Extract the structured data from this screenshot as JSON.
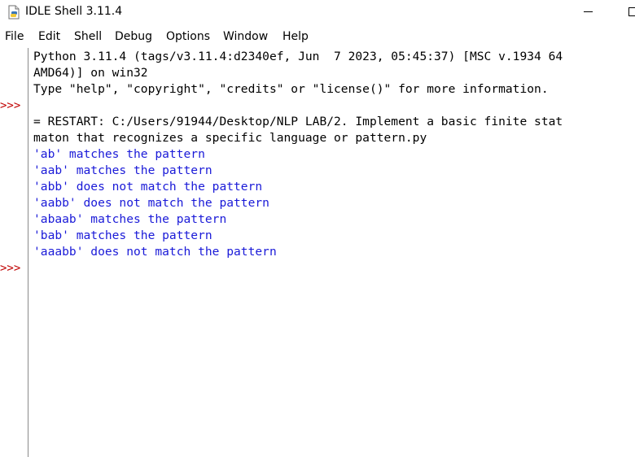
{
  "window": {
    "title": "IDLE Shell 3.11.4",
    "icon": "python-idle-icon"
  },
  "menu": [
    "File",
    "Edit",
    "Shell",
    "Debug",
    "Options",
    "Window",
    "Help"
  ],
  "shell": {
    "prompt": ">>>",
    "lines": [
      "Python 3.11.4 (tags/v3.11.4:d2340ef, Jun  7 2023, 05:45:37) [MSC v.1934 64",
      "AMD64)] on win32",
      "Type \"help\", \"copyright\", \"credits\" or \"license()\" for more information.",
      "",
      "= RESTART: C:/Users/91944/Desktop/NLP LAB/2. Implement a basic finite stat",
      "maton that recognizes a specific language or pattern.py",
      "'ab' matches the pattern",
      "'aab' matches the pattern",
      "'abb' does not match the pattern",
      "'aabb' does not match the pattern",
      "'abaab' matches the pattern",
      "'bab' matches the pattern",
      "'aaabb' does not match the pattern"
    ]
  },
  "colors": {
    "prompt": "#c00000",
    "output": "#1a1ad8",
    "text": "#000000"
  }
}
